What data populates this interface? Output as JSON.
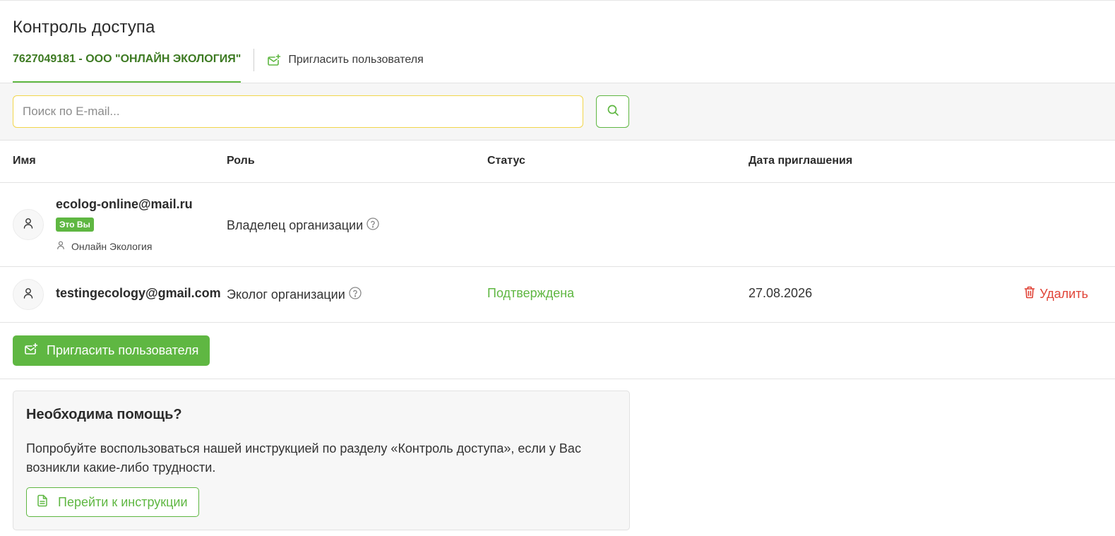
{
  "page": {
    "title": "Контроль доступа"
  },
  "tabs": {
    "organization": "7627049181 - ООО \"ОНЛАЙН ЭКОЛОГИЯ\"",
    "invite": "Пригласить пользователя"
  },
  "search": {
    "placeholder": "Поиск по E-mail...",
    "value": ""
  },
  "table": {
    "columns": [
      "Имя",
      "Роль",
      "Статус",
      "Дата приглашения"
    ],
    "rows": [
      {
        "email": "ecolog-online@mail.ru",
        "badge": "Это Вы",
        "org_name": "Онлайн Экология",
        "role": "Владелец организации",
        "status": "",
        "date": "",
        "action": ""
      },
      {
        "email": "testingecology@gmail.com",
        "badge": "",
        "org_name": "",
        "role": "Эколог организации",
        "status": "Подтверждена",
        "date": "27.08.2026",
        "action": "Удалить"
      }
    ]
  },
  "invite_button": {
    "label": "Пригласить пользователя"
  },
  "help": {
    "title": "Необходима помощь?",
    "text": "Попробуйте воспользоваться нашей инструкцией по разделу «Контроль доступа», если у Вас возникли какие-либо трудности.",
    "button": "Перейти к инструкции"
  },
  "colors": {
    "accent": "#5fb742",
    "accent_dark": "#3d7a22",
    "danger": "#e04337",
    "search_focus": "#f2d64b"
  },
  "icons": {
    "invite": "mail-plus-icon",
    "search": "search-icon",
    "user": "user-icon",
    "help": "question-circle-icon",
    "delete": "trash-icon",
    "document": "document-icon"
  }
}
